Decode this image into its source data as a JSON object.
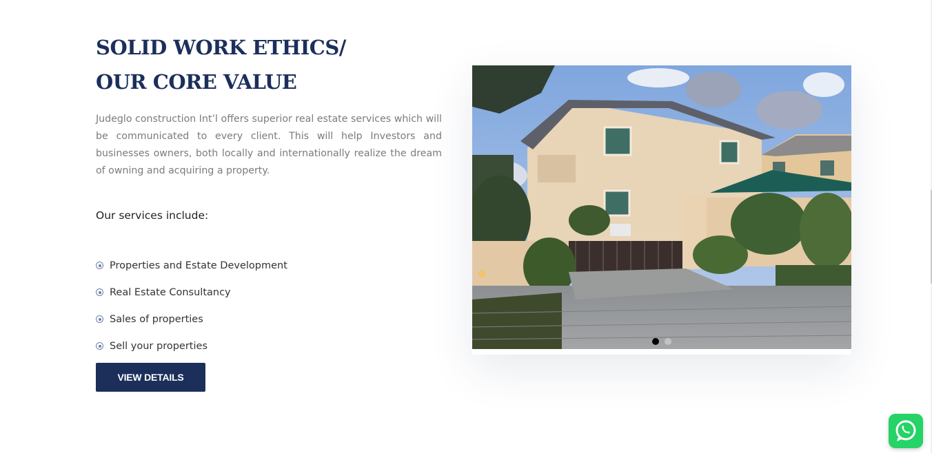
{
  "heading": {
    "line1": "SOLID WORK ETHICS/",
    "line2": "OUR CORE VALUE"
  },
  "intro": "Judeglo construction Int’l offers superior real estate services which will be communicated to every client. This will help Investors and businesses owners, both locally and internationally realize the dream of owning and acquiring a property.",
  "services": {
    "title": "Our services include:",
    "items": [
      {
        "label": "Properties and Estate Development",
        "icon": "target-bullet-icon"
      },
      {
        "label": "Real Estate Consultancy",
        "icon": "target-bullet-icon"
      },
      {
        "label": "Sales of properties",
        "icon": "target-bullet-icon"
      },
      {
        "label": "Sell your properties",
        "icon": "target-bullet-icon"
      }
    ]
  },
  "cta": {
    "label": "VIEW DETAILS"
  },
  "slider": {
    "active_slide": 1,
    "slide_count": 2,
    "image": "house-photo"
  },
  "whatsapp": {
    "icon": "whatsapp-icon"
  },
  "colors": {
    "primary": "#1c2f5b",
    "body_text": "#7b7b7b",
    "whatsapp": "#25d366"
  }
}
